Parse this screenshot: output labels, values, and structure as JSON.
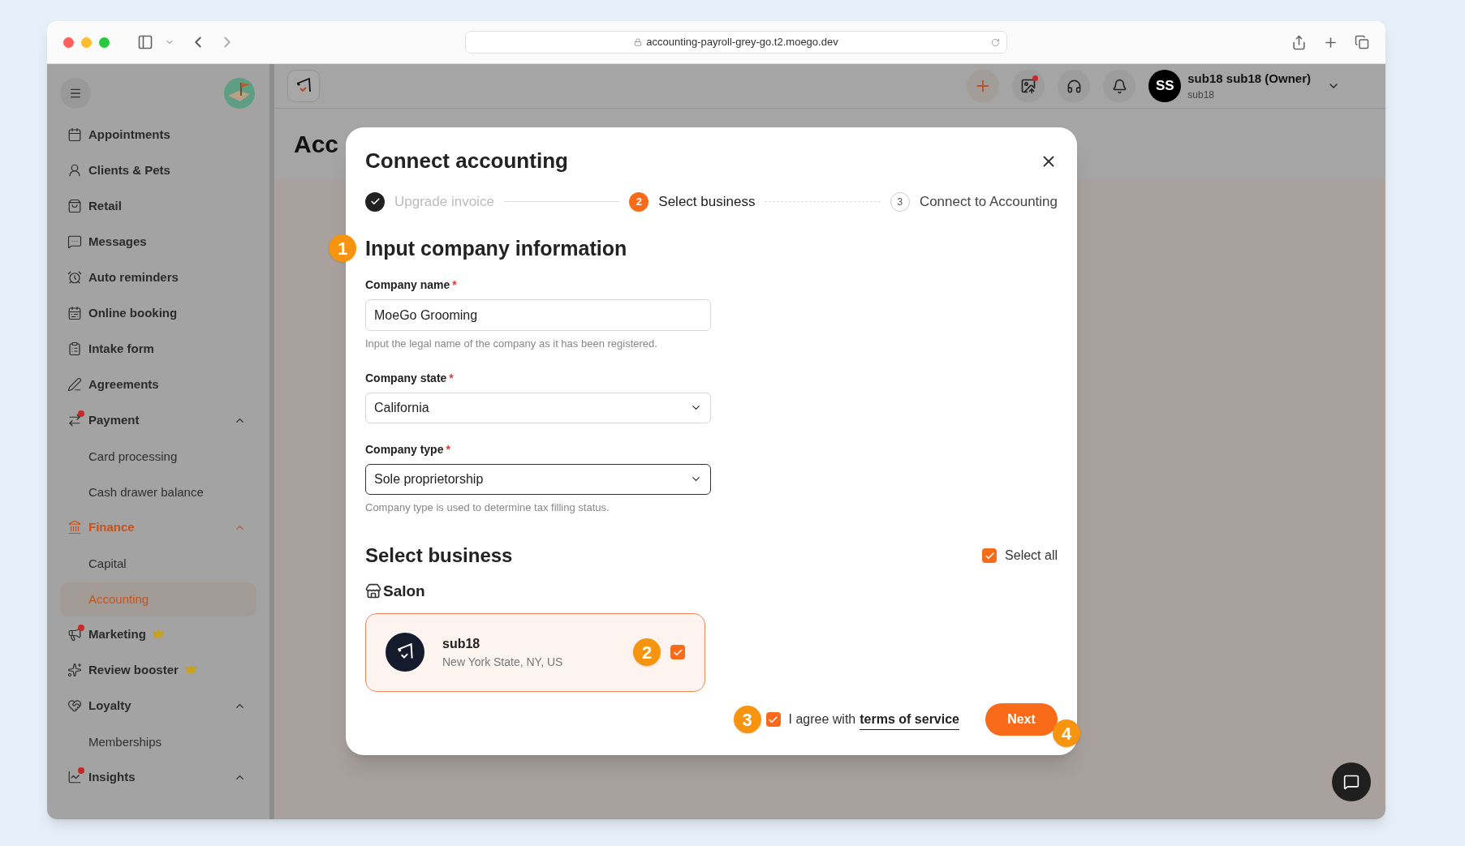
{
  "browser": {
    "url": "accounting-payroll-grey-go.t2.moego.dev"
  },
  "sidebar": {
    "items": [
      {
        "label": "Appointments",
        "active": false,
        "dot": false,
        "crown": false
      },
      {
        "label": "Clients & Pets",
        "active": false,
        "dot": false,
        "crown": false
      },
      {
        "label": "Retail",
        "active": false,
        "dot": false,
        "crown": false
      },
      {
        "label": "Messages",
        "active": false,
        "dot": false,
        "crown": false
      },
      {
        "label": "Auto reminders",
        "active": false,
        "dot": false,
        "crown": false
      },
      {
        "label": "Online booking",
        "active": false,
        "dot": false,
        "crown": false
      },
      {
        "label": "Intake form",
        "active": false,
        "dot": false,
        "crown": false
      },
      {
        "label": "Agreements",
        "active": false,
        "dot": false,
        "crown": false
      },
      {
        "label": "Payment",
        "active": false,
        "dot": true,
        "crown": false,
        "expanded": true,
        "children": [
          {
            "label": "Card processing",
            "selected": false
          },
          {
            "label": "Cash drawer balance",
            "selected": false
          }
        ]
      },
      {
        "label": "Finance",
        "active": true,
        "dot": false,
        "crown": false,
        "expanded": true,
        "children": [
          {
            "label": "Capital",
            "selected": false
          },
          {
            "label": "Accounting",
            "selected": true
          }
        ]
      },
      {
        "label": "Marketing",
        "active": false,
        "dot": true,
        "crown": true
      },
      {
        "label": "Review booster",
        "active": false,
        "dot": false,
        "crown": true
      },
      {
        "label": "Loyalty",
        "active": false,
        "dot": false,
        "crown": false,
        "expanded": true,
        "children": [
          {
            "label": "Memberships",
            "selected": false
          }
        ]
      },
      {
        "label": "Insights",
        "active": false,
        "dot": true,
        "crown": false,
        "expanded": true
      }
    ]
  },
  "header": {
    "user_initials": "SS",
    "user_name": "sub18 sub18 (Owner)",
    "user_sub": "sub18",
    "upload_dot": true
  },
  "page_title": "Acc",
  "dialog": {
    "title": "Connect accounting",
    "steps": [
      {
        "label": "Upgrade invoice",
        "done": true,
        "selected": false
      },
      {
        "label": "Select business",
        "done": false,
        "selected": true,
        "number": "2"
      },
      {
        "label": "Connect to Accounting",
        "done": false,
        "selected": false,
        "number": "3"
      }
    ],
    "section_title": "Input company information",
    "fields": [
      {
        "kind": "input",
        "label": "Company name",
        "required_mark": "*",
        "value": "MoeGo Grooming",
        "help": "Input the legal name of the company as it has been registered.",
        "focused": false
      },
      {
        "kind": "select",
        "label": "Company state",
        "required_mark": "*",
        "value": "California",
        "focused": false
      },
      {
        "kind": "select",
        "label": "Company type",
        "required_mark": "*",
        "value": "Sole proprietorship",
        "help": "Company type is used to determine tax filling status.",
        "focused": true
      }
    ],
    "business_title": "Select business",
    "select_all": {
      "label": "Select all",
      "checked": true
    },
    "group": "Salon",
    "businesses": [
      {
        "name": "sub18",
        "address": "New York State, NY, US",
        "checked": true
      }
    ],
    "agree": {
      "checked": true,
      "text": "I agree with",
      "link": "terms of service"
    },
    "next_button": "Next"
  },
  "markers": [
    "1",
    "2",
    "3",
    "4"
  ]
}
